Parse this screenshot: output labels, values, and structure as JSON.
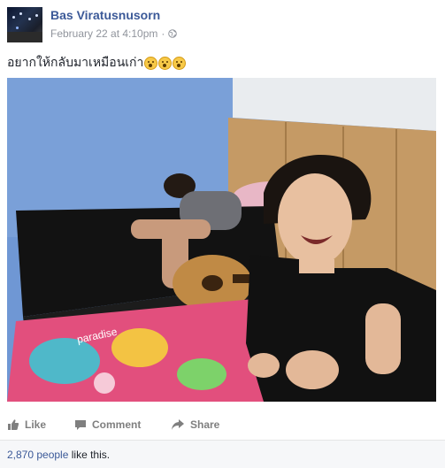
{
  "post": {
    "author": "Bas Viratusnusorn",
    "timestamp": "February 22 at 4:10pm",
    "separator": "·",
    "audience_icon": "globe-icon",
    "caption": "อยากให้กลับมาเหมือนเก่า",
    "caption_emojis": [
      "astonished-emoji",
      "astonished-emoji",
      "astonished-emoji"
    ]
  },
  "actions": {
    "like_label": "Like",
    "comment_label": "Comment",
    "share_label": "Share"
  },
  "likes": {
    "count_text": "2,870 people",
    "suffix": " like this."
  },
  "colors": {
    "link_blue": "#3b5998",
    "muted_text": "#90949c",
    "action_gray": "#7f7f7f",
    "footer_bg": "#f6f7f9"
  }
}
